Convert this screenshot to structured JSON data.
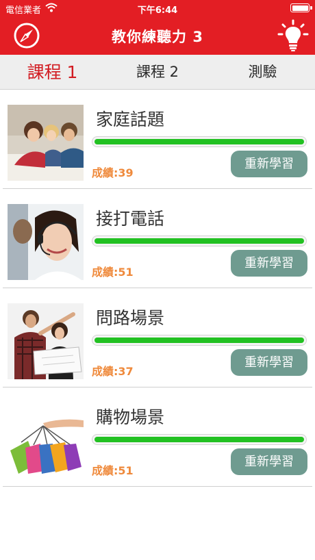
{
  "status_bar": {
    "carrier": "電信業者",
    "time": "下午6:44"
  },
  "header": {
    "title": "教你練聽力 3",
    "left_icon": "compass-icon",
    "right_icon": "lightbulb-icon"
  },
  "tabs": [
    {
      "label": "課程 1",
      "active": true
    },
    {
      "label": "課程 2",
      "active": false
    },
    {
      "label": "測驗",
      "active": false
    }
  ],
  "lessons": [
    {
      "title": "家庭話題",
      "score": "成績:39",
      "progress": 1.0,
      "button": "重新學習",
      "image": "family-photo"
    },
    {
      "title": "接打電話",
      "score": "成績:51",
      "progress": 1.0,
      "button": "重新學習",
      "image": "headset-operator-photo"
    },
    {
      "title": "問路場景",
      "score": "成績:37",
      "progress": 1.0,
      "button": "重新學習",
      "image": "asking-directions-photo"
    },
    {
      "title": "購物場景",
      "score": "成績:51",
      "progress": 1.0,
      "button": "重新學習",
      "image": "shopping-bags-photo"
    }
  ],
  "colors": {
    "brand": "#e31e24",
    "progress": "#22c122",
    "score": "#ef8a3c",
    "button": "#6f9b90"
  }
}
